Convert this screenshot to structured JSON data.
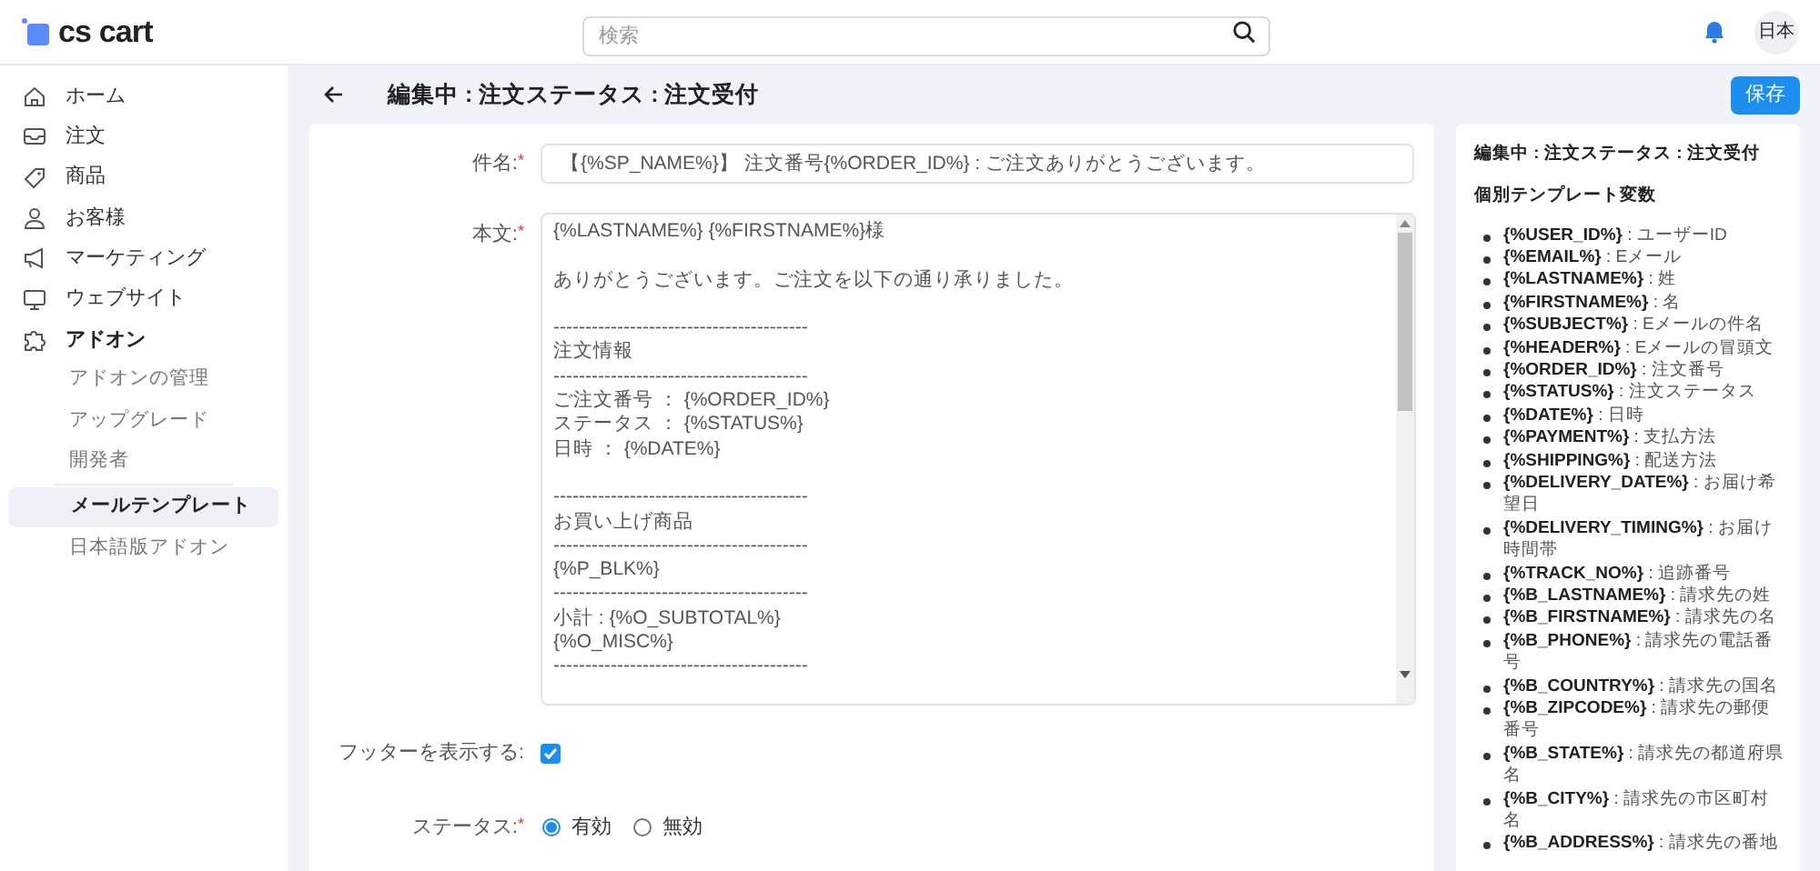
{
  "header": {
    "logo": "cs cart",
    "search": {
      "placeholder": "検索"
    },
    "language": "日本"
  },
  "sidebar": {
    "items": [
      {
        "label": "ホーム",
        "selected": false
      },
      {
        "label": "注文",
        "selected": false
      },
      {
        "label": "商品",
        "selected": false
      },
      {
        "label": "お客様",
        "selected": false
      },
      {
        "label": "マーケティング",
        "selected": false
      },
      {
        "label": "ウェブサイト",
        "selected": false
      },
      {
        "label": "アドオン",
        "selected": false,
        "expanded": true,
        "children": [
          {
            "label": "アドオンの管理",
            "selected": false
          },
          {
            "label": "アップグレード",
            "selected": false
          },
          {
            "label": "開発者",
            "selected": false
          },
          {
            "label": "メールテンプレート",
            "selected": true
          },
          {
            "label": "日本語版アドオン",
            "selected": false
          }
        ]
      }
    ]
  },
  "page": {
    "title": "編集中 : 注文ステータス : 注文受付",
    "save_button": "保存"
  },
  "form": {
    "subject": {
      "label": "件名:",
      "required_mark": "*",
      "value": "【{%SP_NAME%}】 注文番号{%ORDER_ID%} : ご注文ありがとうございます。"
    },
    "body": {
      "label": "本文:",
      "required_mark": "*",
      "paragraphs": [
        [
          "{%LASTNAME%} {%FIRSTNAME%}様"
        ],
        [
          "ありがとうございます。ご注文を以下の通り承りました。"
        ],
        [
          "----------------------------------------",
          "注文情報",
          "----------------------------------------",
          "ご注文番号 ： {%ORDER_ID%}",
          "ステータス ： {%STATUS%}",
          "日時 ： {%DATE%}"
        ],
        [
          "----------------------------------------",
          "お買い上げ商品",
          "----------------------------------------",
          "{%P_BLK%}",
          "----------------------------------------",
          "小計 : {%O_SUBTOTAL%}",
          "{%O_MISC%}",
          "----------------------------------------"
        ]
      ]
    },
    "footer": {
      "label": "フッターを表示する:",
      "checked": true
    },
    "status": {
      "label": "ステータス:",
      "required_mark": "*",
      "options": [
        {
          "label": "有効",
          "selected": true
        },
        {
          "label": "無効",
          "selected": false
        }
      ]
    }
  },
  "variables": {
    "title": "編集中 : 注文ステータス : 注文受付",
    "subtitle": "個別テンプレート変数",
    "items": [
      "**{%USER_ID%}** : ユーザーID",
      "**{%EMAIL%}** : Eメール",
      "**{%LASTNAME%}** : 姓",
      "**{%FIRSTNAME%}** : 名",
      "**{%SUBJECT%}** : Eメールの件名",
      "**{%HEADER%}** : Eメールの冒頭文",
      "**{%ORDER_ID%}** : 注文番号",
      "**{%STATUS%}** : 注文ステータス",
      "**{%DATE%}** : 日時",
      "**{%PAYMENT%}** : 支払方法",
      "**{%SHIPPING%}** : 配送方法",
      "**{%DELIVERY_DATE%}** : お届け希望日",
      "**{%DELIVERY_TIMING%}** : お届け時間帯",
      "**{%TRACK_NO%}** : 追跡番号",
      "**{%B_LASTNAME%}** : 請求先の姓",
      "**{%B_FIRSTNAME%}** : 請求先の名",
      "**{%B_PHONE%}** : 請求先の電話番号",
      "**{%B_COUNTRY%}** : 請求先の国名",
      "**{%B_ZIPCODE%}** : 請求先の郵便番号",
      "**{%B_STATE%}** : 請求先の都道府県名",
      "**{%B_CITY%}** : 請求先の市区町村名",
      "**{%B_ADDRESS%}** : 請求先の番地"
    ]
  }
}
